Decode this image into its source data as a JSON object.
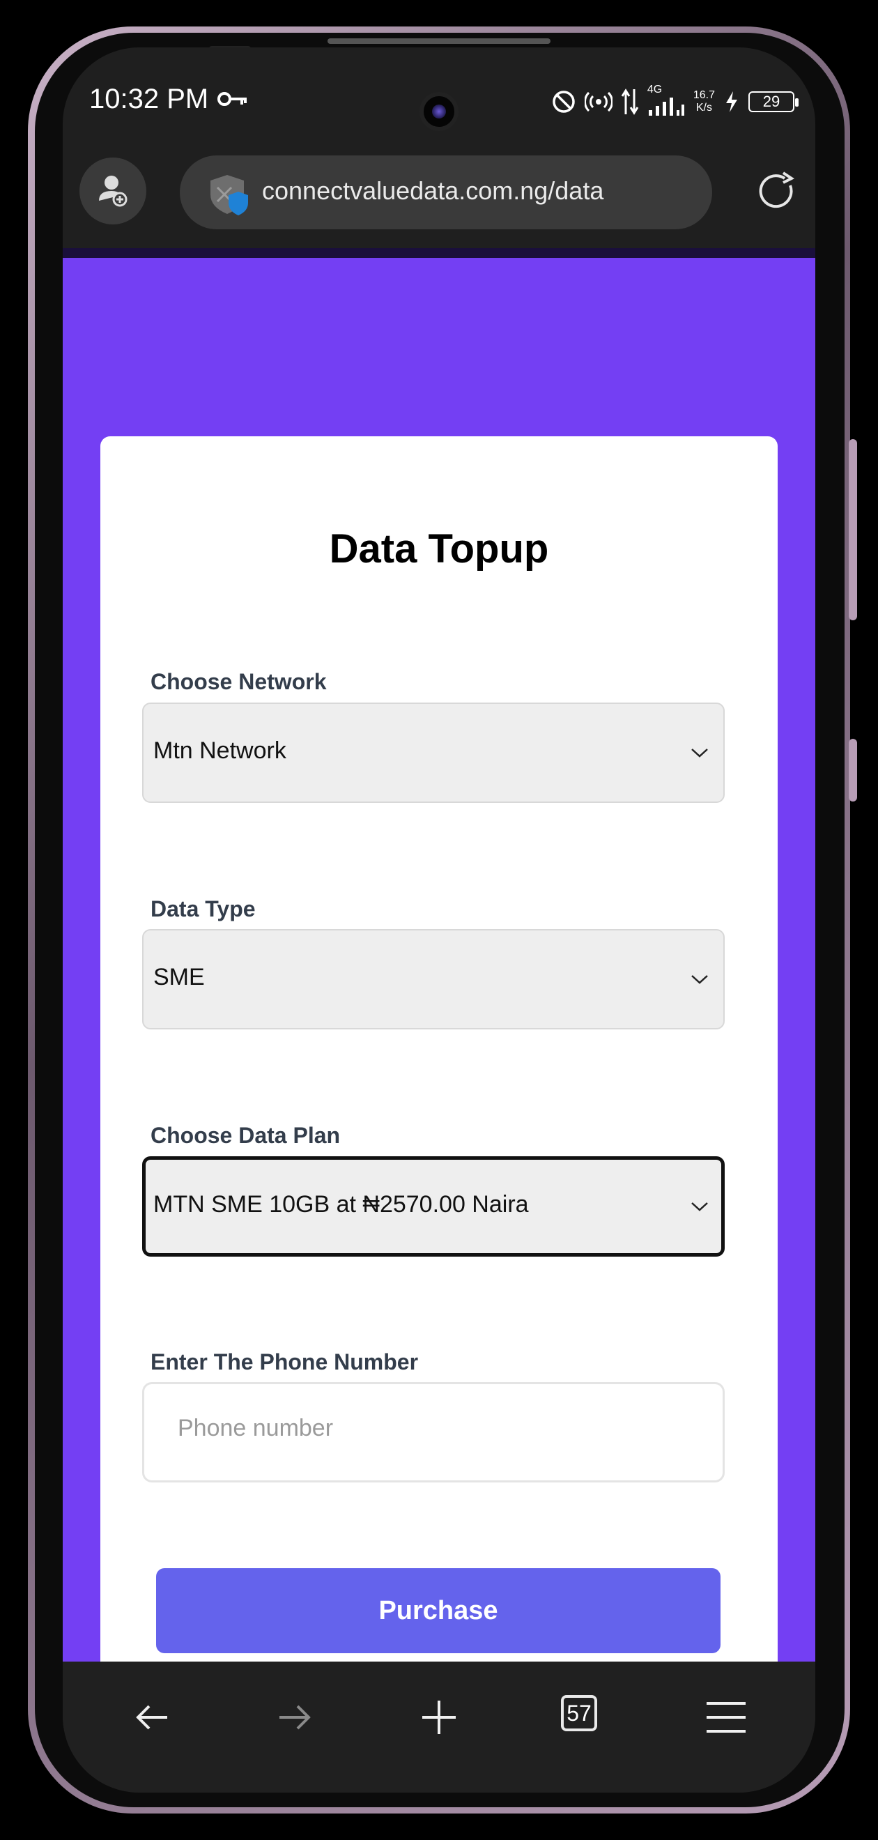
{
  "status_bar": {
    "time": "10:32 PM",
    "network_type": "4G",
    "speed_value": "16.7",
    "speed_unit": "K/s",
    "battery": "29",
    "icons": [
      "key-icon",
      "dnd-icon",
      "hotspot-icon",
      "data-arrows-icon",
      "signal-icon",
      "charging-icon",
      "battery-icon"
    ]
  },
  "browser": {
    "url": "connectvaluedata.com.ng/data",
    "tab_count": "57",
    "icons": [
      "profile-add-icon",
      "shield-icon",
      "reload-icon",
      "back-arrow-icon",
      "forward-arrow-icon",
      "plus-icon",
      "tabs-icon",
      "menu-icon"
    ]
  },
  "page": {
    "background_color": "#743ff3",
    "title": "Data Topup",
    "network": {
      "label": "Choose Network",
      "value": "Mtn Network"
    },
    "data_type": {
      "label": "Data Type",
      "value": "SME"
    },
    "data_plan": {
      "label": "Choose Data Plan",
      "value": "MTN SME 10GB at ₦2570.00 Naira"
    },
    "phone": {
      "label": "Enter The Phone Number",
      "placeholder": "Phone number",
      "value": ""
    },
    "purchase_label": "Purchase",
    "button_color": "#6463ec"
  }
}
